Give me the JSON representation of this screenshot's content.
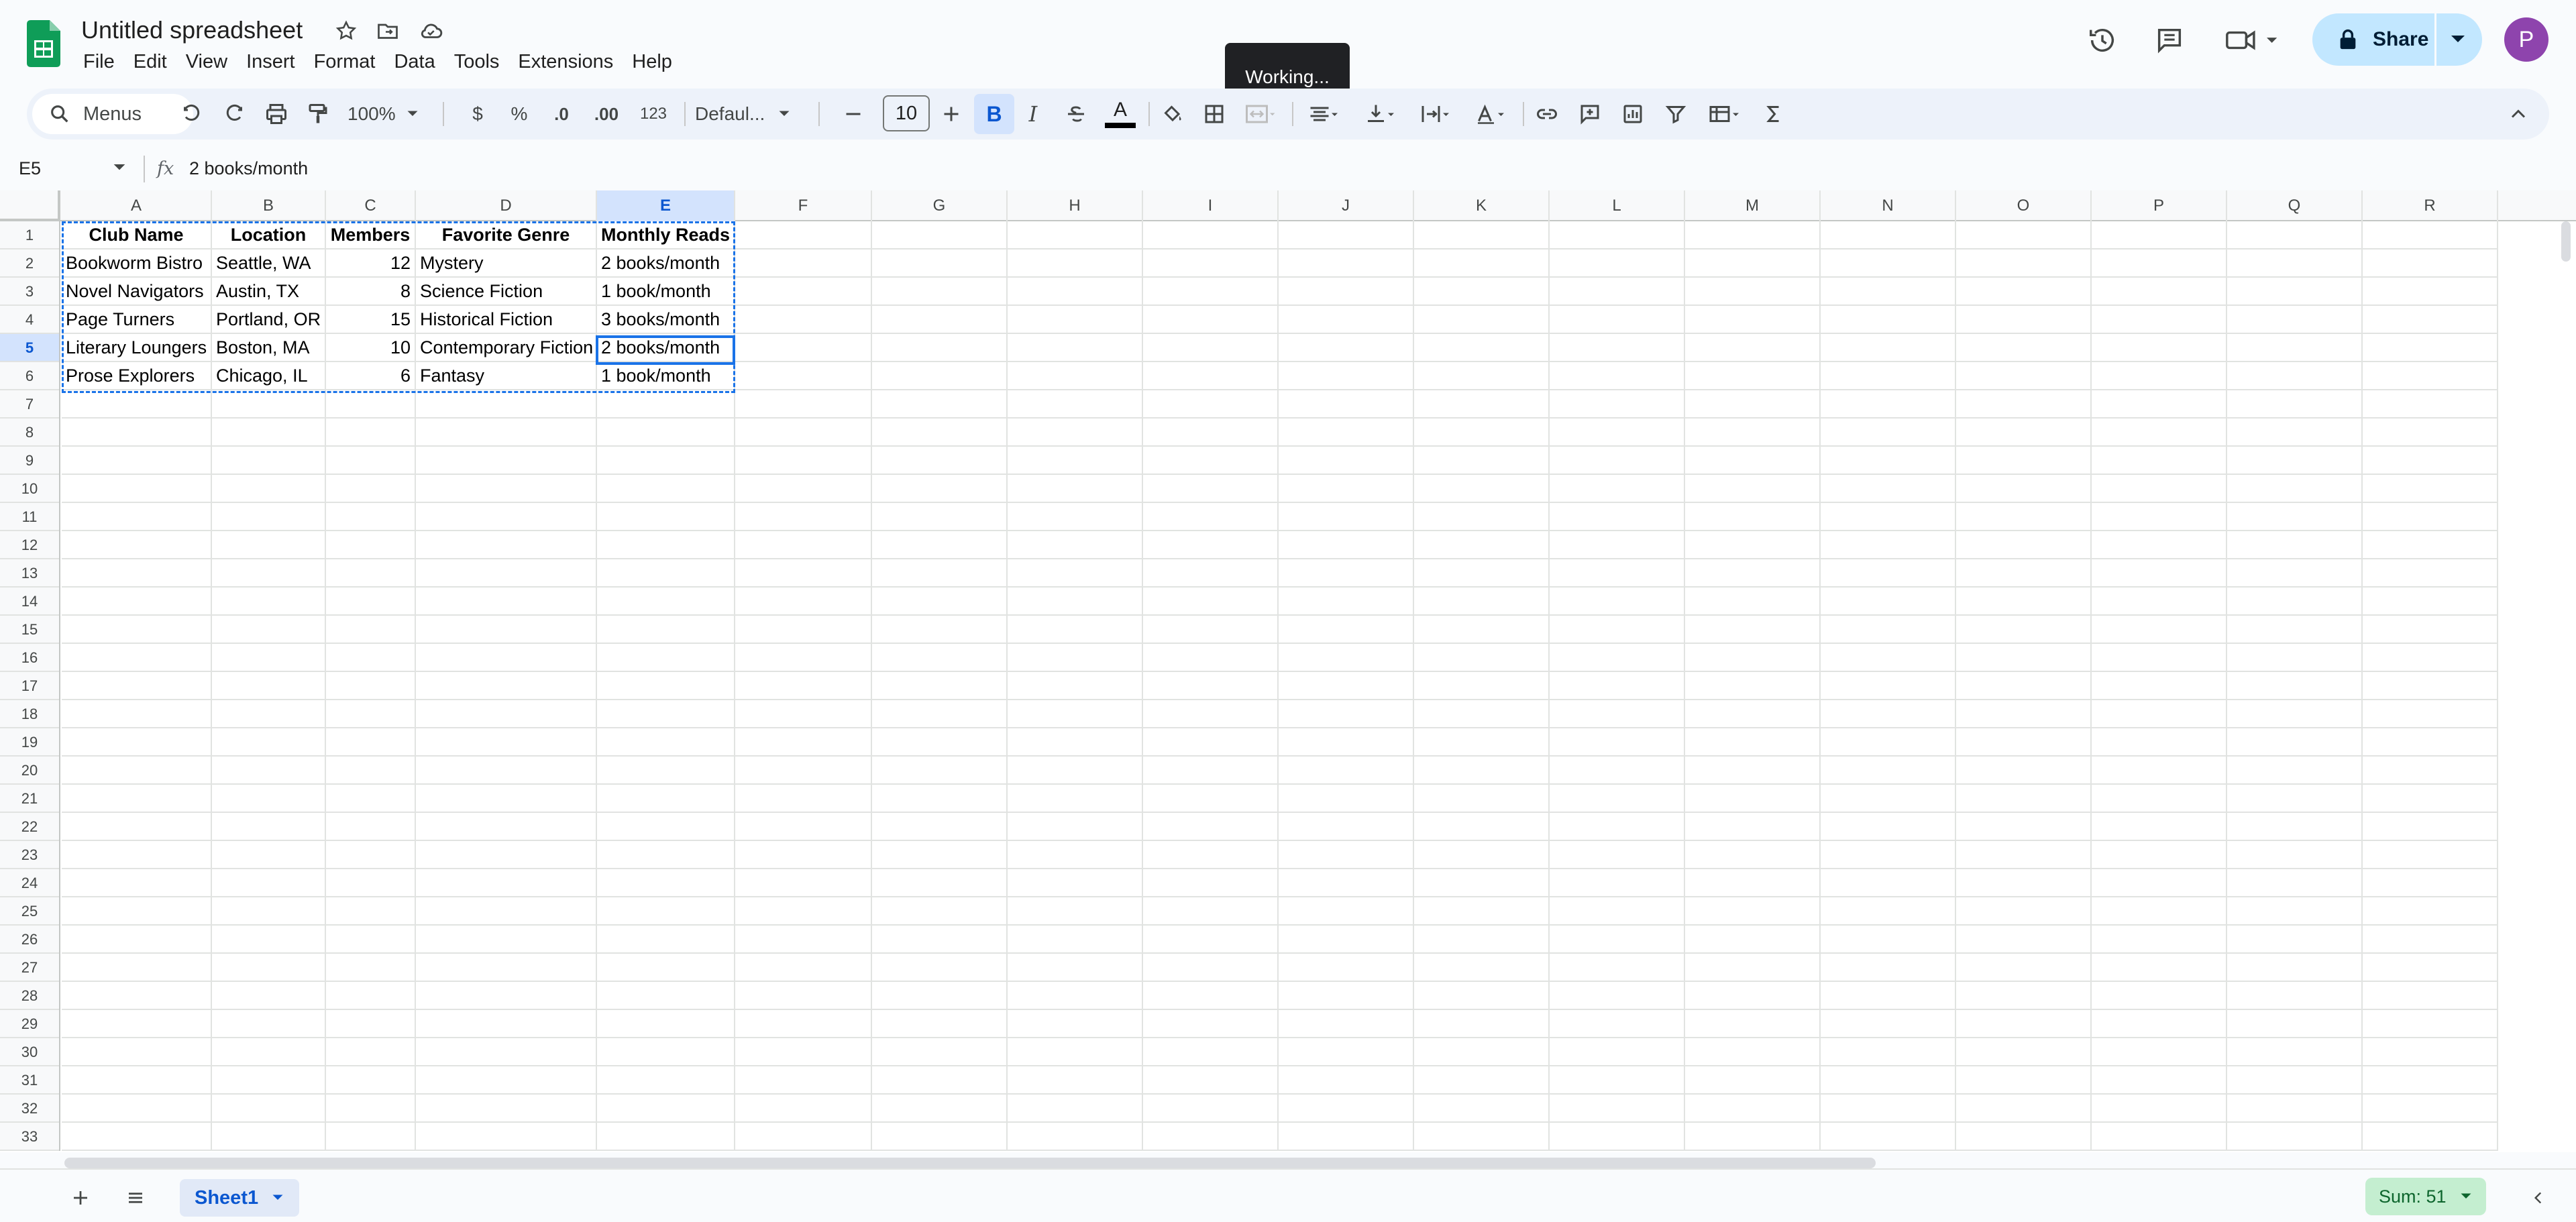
{
  "app": {
    "doc_title": "Untitled spreadsheet",
    "menus": [
      "File",
      "Edit",
      "View",
      "Insert",
      "Format",
      "Data",
      "Tools",
      "Extensions",
      "Help"
    ],
    "share_label": "Share",
    "avatar_initial": "P",
    "toast": "Working..."
  },
  "toolbar": {
    "search_menus": "Menus",
    "zoom": "100%",
    "currency": "$",
    "percent": "%",
    "dec_decrease": ".0",
    "dec_increase": ".00",
    "number_format": "123",
    "font": "Defaul...",
    "font_size": "10",
    "bold": "B",
    "italic": "I",
    "text_color_letter": "A"
  },
  "formula_bar": {
    "name_box": "E5",
    "fx": "fx",
    "value": "2 books/month"
  },
  "sheet": {
    "columns": [
      "A",
      "B",
      "C",
      "D",
      "E",
      "F",
      "G",
      "H",
      "I",
      "J",
      "K",
      "L",
      "M",
      "N",
      "O",
      "P",
      "Q",
      "R"
    ],
    "selected_column": "E",
    "selected_row": 5,
    "row_count": 33,
    "header_row": [
      "Club Name",
      "Location",
      "Members",
      "Favorite Genre",
      "Monthly Reads"
    ],
    "rows": [
      [
        "Bookworm Bistro",
        "Seattle, WA",
        "12",
        "Mystery",
        "2 books/month"
      ],
      [
        "Novel Navigators",
        "Austin, TX",
        "8",
        "Science Fiction",
        "1 book/month"
      ],
      [
        "Page Turners",
        "Portland, OR",
        "15",
        "Historical Fiction",
        "3 books/month"
      ],
      [
        "Literary Loungers",
        "Boston, MA",
        "10",
        "Contemporary Fiction",
        "2 books/month"
      ],
      [
        "Prose Explorers",
        "Chicago, IL",
        "6",
        "Fantasy",
        "1 book/month"
      ]
    ]
  },
  "bottom": {
    "sheet_tab": "Sheet1",
    "sum": "Sum: 51"
  }
}
